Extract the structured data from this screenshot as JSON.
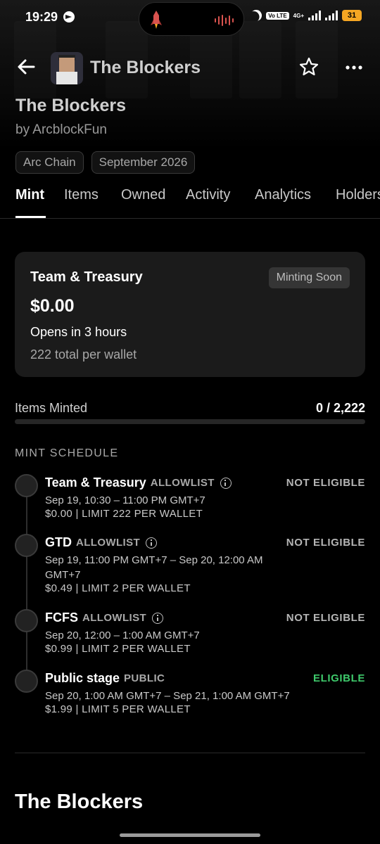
{
  "status_bar": {
    "time": "19:29",
    "volte_label": "Vo LTE",
    "network_label": "4G+",
    "battery": "31",
    "colors": {
      "battery": "#f5a623",
      "wave": "#d9534f"
    }
  },
  "appbar": {
    "title": "The Blockers"
  },
  "collection": {
    "title": "The Blockers",
    "creator": "by ArcblockFun",
    "chips": [
      "Arc Chain",
      "September 2026"
    ]
  },
  "tabs": [
    {
      "label": "Mint",
      "active": true
    },
    {
      "label": "Items"
    },
    {
      "label": "Owned"
    },
    {
      "label": "Activity"
    },
    {
      "label": "Analytics"
    },
    {
      "label": "Holders"
    }
  ],
  "mint_card": {
    "name": "Team & Treasury",
    "badge": "Minting Soon",
    "price": "$0.00",
    "opens": "Opens in 3 hours",
    "per_wallet": "222 total per wallet"
  },
  "minted": {
    "label": "Items Minted",
    "value": "0 / 2,222",
    "progress_fraction": 0
  },
  "schedule": {
    "heading": "MINT SCHEDULE",
    "stages": [
      {
        "name": "Team & Treasury",
        "kind": "ALLOWLIST",
        "info": true,
        "status": "NOT ELIGIBLE",
        "eligible": false,
        "time": "Sep 19, 10:30 – 11:00 PM GMT+7",
        "limit": "$0.00 | LIMIT 222 PER WALLET"
      },
      {
        "name": "GTD",
        "kind": "ALLOWLIST",
        "info": true,
        "status": "NOT ELIGIBLE",
        "eligible": false,
        "time": "Sep 19, 11:00 PM GMT+7 – Sep 20, 12:00 AM GMT+7",
        "limit": "$0.49 | LIMIT 2 PER WALLET"
      },
      {
        "name": "FCFS",
        "kind": "ALLOWLIST",
        "info": true,
        "status": "NOT ELIGIBLE",
        "eligible": false,
        "time": "Sep 20, 12:00 – 1:00 AM GMT+7",
        "limit": "$0.99 | LIMIT 2 PER WALLET"
      },
      {
        "name": "Public stage",
        "kind": "PUBLIC",
        "info": false,
        "status": "ELIGIBLE",
        "eligible": true,
        "time": "Sep 20, 1:00 AM GMT+7 – Sep 21, 1:00 AM GMT+7",
        "limit": "$1.99 | LIMIT 5 PER WALLET"
      }
    ]
  },
  "bottom": {
    "title": "The Blockers"
  },
  "colors": {
    "background": "#000000",
    "card": "#1b1b1b",
    "eligible": "#3ec96b",
    "muted": "#a8a8a8"
  }
}
